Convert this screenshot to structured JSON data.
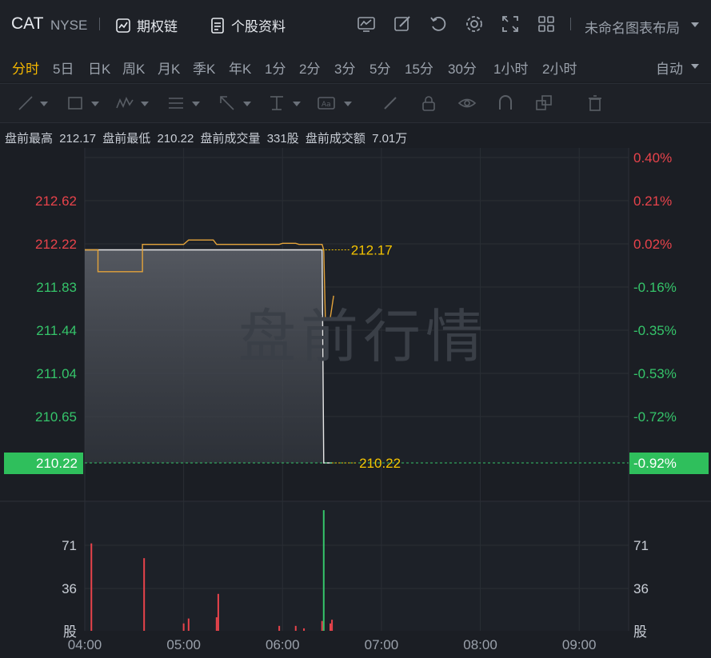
{
  "header": {
    "ticker": "CAT",
    "exchange": "NYSE",
    "options_chain": "期权链",
    "stock_info": "个股资料",
    "layout_name": "未命名图表布局",
    "icons": [
      "indicator-icon",
      "draw-icon",
      "reset-icon",
      "settings-icon",
      "fullscreen-icon",
      "grid-layout-icon"
    ]
  },
  "periods": {
    "items": [
      "分时",
      "5日",
      "日K",
      "周K",
      "月K",
      "季K",
      "年K",
      "1分",
      "2分",
      "3分",
      "5分",
      "15分",
      "30分",
      "1小时",
      "2小时"
    ],
    "active": "分时",
    "auto_label": "自动"
  },
  "drawing_tools": [
    "trendline-icon",
    "rectangle-icon",
    "pattern-icon",
    "fibonacci-icon",
    "arrow-icon",
    "price-range-icon",
    "text-icon",
    "pen-icon",
    "lock-icon",
    "eye-icon",
    "magnet-icon",
    "clone-icon",
    "trash-icon"
  ],
  "premarket": {
    "high_label": "盘前最高",
    "high_value": "212.17",
    "low_label": "盘前最低",
    "low_value": "210.22",
    "volume_label": "盘前成交量",
    "volume_value": "331股",
    "turnover_label": "盘前成交额",
    "turnover_value": "7.01万"
  },
  "watermark": "盘前行情",
  "colors": {
    "up": "#e8434b",
    "down": "#35c46a",
    "avg_line": "#e3a33a",
    "price_line": "#e6e6e6",
    "marker_bg": "#2fbf5c",
    "label_yellow": "#f5c400"
  },
  "chart_data": {
    "type": "line",
    "price_axis_labels": [
      "212.62",
      "212.22",
      "211.83",
      "211.44",
      "211.04",
      "210.65"
    ],
    "percent_axis_labels": [
      "0.40%",
      "0.21%",
      "0.02%",
      "-0.16%",
      "-0.35%",
      "-0.53%",
      "-0.72%"
    ],
    "current_price_label": "210.22",
    "current_percent_label": "-0.92%",
    "high_marker_label": "212.17",
    "low_marker_label": "210.22",
    "x_ticks": [
      "04:00",
      "05:00",
      "06:00",
      "07:00",
      "08:00",
      "09:00"
    ],
    "xlim": [
      "04:00",
      "09:30"
    ],
    "ylim": [
      210.22,
      212.62
    ],
    "price_series": [
      {
        "t": "04:00",
        "v": 212.17
      },
      {
        "t": "06:24",
        "v": 212.17
      },
      {
        "t": "06:25",
        "v": 210.22
      },
      {
        "t": "06:30",
        "v": 210.22
      }
    ],
    "average_series": [
      {
        "t": "04:00",
        "v": 212.17
      },
      {
        "t": "04:08",
        "v": 212.17
      },
      {
        "t": "04:08",
        "v": 211.97
      },
      {
        "t": "04:35",
        "v": 211.97
      },
      {
        "t": "04:35",
        "v": 212.22
      },
      {
        "t": "05:00",
        "v": 212.22
      },
      {
        "t": "05:03",
        "v": 212.26
      },
      {
        "t": "05:18",
        "v": 212.26
      },
      {
        "t": "05:20",
        "v": 212.22
      },
      {
        "t": "05:58",
        "v": 212.22
      },
      {
        "t": "06:00",
        "v": 212.23
      },
      {
        "t": "06:08",
        "v": 212.23
      },
      {
        "t": "06:10",
        "v": 212.22
      },
      {
        "t": "06:24",
        "v": 212.22
      },
      {
        "t": "06:25",
        "v": 212.17
      },
      {
        "t": "06:26",
        "v": 211.53
      },
      {
        "t": "06:29",
        "v": 211.55
      },
      {
        "t": "06:31",
        "v": 211.75
      }
    ],
    "volume_axis_labels": [
      "71",
      "36",
      "股"
    ],
    "volume_ylim": [
      0,
      100
    ],
    "volume_bars": [
      {
        "t": "04:04",
        "v": 71,
        "dir": "up"
      },
      {
        "t": "04:36",
        "v": 59,
        "dir": "up"
      },
      {
        "t": "05:00",
        "v": 6,
        "dir": "up"
      },
      {
        "t": "05:03",
        "v": 10,
        "dir": "up"
      },
      {
        "t": "05:20",
        "v": 11,
        "dir": "up"
      },
      {
        "t": "05:21",
        "v": 30,
        "dir": "up"
      },
      {
        "t": "05:58",
        "v": 4,
        "dir": "up"
      },
      {
        "t": "06:08",
        "v": 4,
        "dir": "up"
      },
      {
        "t": "06:13",
        "v": 2,
        "dir": "up"
      },
      {
        "t": "06:24",
        "v": 8,
        "dir": "up"
      },
      {
        "t": "06:25",
        "v": 98,
        "dir": "down"
      },
      {
        "t": "06:29",
        "v": 6,
        "dir": "up"
      },
      {
        "t": "06:30",
        "v": 9,
        "dir": "up"
      }
    ]
  }
}
